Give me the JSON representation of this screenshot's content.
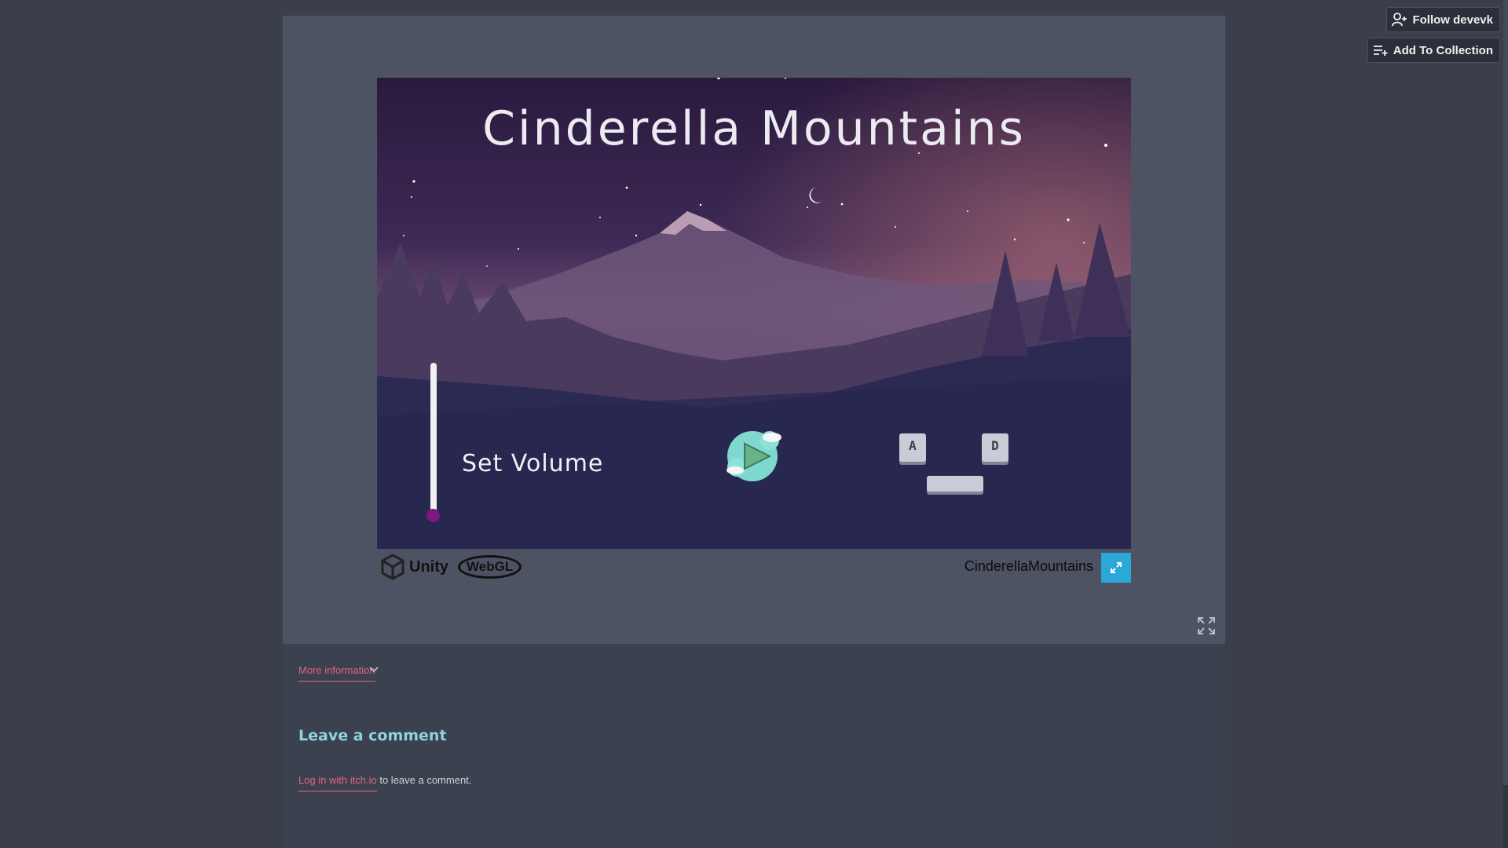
{
  "game": {
    "title": "Cinderella Mountains",
    "volume_label": "Set Volume",
    "volume_level": 0,
    "keys": {
      "left": "A",
      "right": "D"
    }
  },
  "footer": {
    "engine": "Unity",
    "platform": "WebGL",
    "build_title": "CinderellaMountains"
  },
  "page": {
    "more_info": "More information",
    "comment_heading": "Leave a comment",
    "login_link": "Log in with itch.io",
    "login_suffix": " to leave a comment."
  },
  "top_buttons": {
    "follow": "Follow devevk",
    "collection": "Add To Collection"
  },
  "colors": {
    "accent_link": "#e2637d",
    "heading": "#8fd3e0",
    "fullscreen": "#2aa9d8",
    "volume_thumb": "#7a1a7e"
  }
}
